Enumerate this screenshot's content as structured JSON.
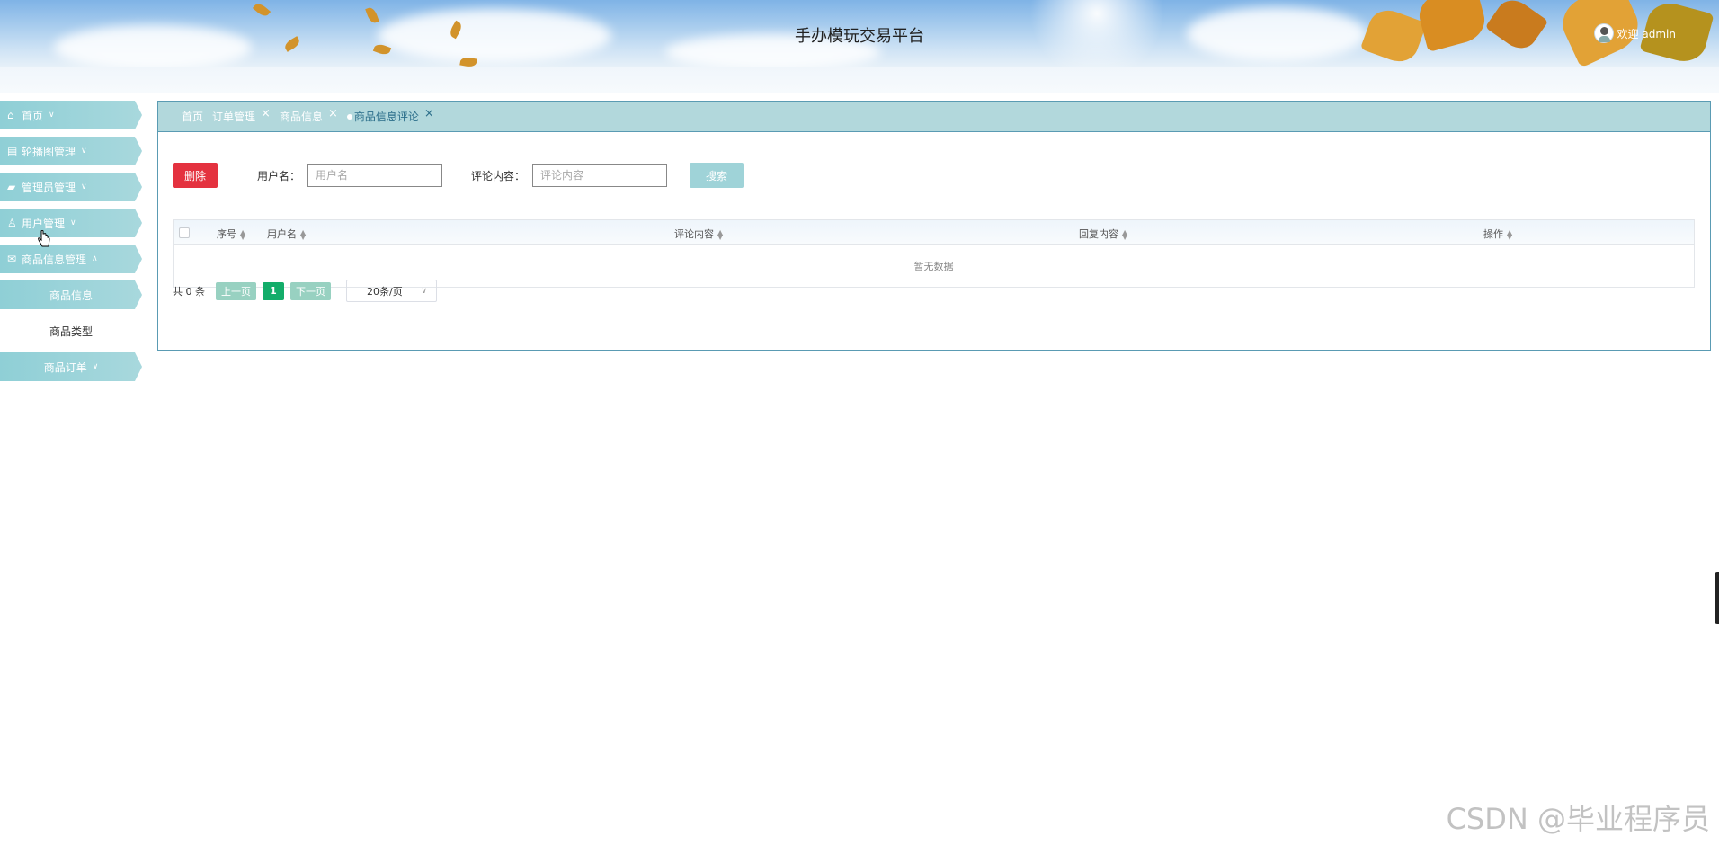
{
  "header": {
    "title": "手办模玩交易平台",
    "welcome": "欢迎 admin"
  },
  "sidebar": {
    "items": [
      {
        "label": "首页",
        "icon": "home-icon",
        "expanded": false
      },
      {
        "label": "轮播图管理",
        "icon": "carousel-icon",
        "expanded": false
      },
      {
        "label": "管理员管理",
        "icon": "admin-icon",
        "expanded": false
      },
      {
        "label": "用户管理",
        "icon": "user-icon",
        "expanded": false
      },
      {
        "label": "商品信息管理",
        "icon": "mail-icon",
        "expanded": true,
        "children": [
          {
            "label": "商品信息",
            "active": true
          },
          {
            "label": "商品类型",
            "active": false
          }
        ]
      },
      {
        "label": "商品订单",
        "icon": "",
        "expanded": false
      }
    ]
  },
  "tabs": [
    {
      "label": "首页",
      "closable": false,
      "active": false
    },
    {
      "label": "订单管理",
      "closable": true,
      "active": false
    },
    {
      "label": "商品信息",
      "closable": true,
      "active": false
    },
    {
      "label": "商品信息评论",
      "closable": true,
      "active": true
    }
  ],
  "toolbar": {
    "delete_label": "删除",
    "username_label": "用户名：",
    "username_placeholder": "用户名",
    "content_label": "评论内容：",
    "content_placeholder": "评论内容",
    "search_label": "搜索"
  },
  "table": {
    "columns": [
      "序号",
      "用户名",
      "评论内容",
      "回复内容",
      "操作"
    ],
    "rows": [],
    "empty_text": "暂无数据"
  },
  "pagination": {
    "total_text": "共 0 条",
    "prev_label": "上一页",
    "current_page": "1",
    "next_label": "下一页",
    "page_size": "20条/页"
  },
  "watermark": "CSDN @毕业程序员",
  "colors": {
    "accent": "#a8d8dd",
    "danger": "#e4323f",
    "active_page": "#13ad6a"
  }
}
